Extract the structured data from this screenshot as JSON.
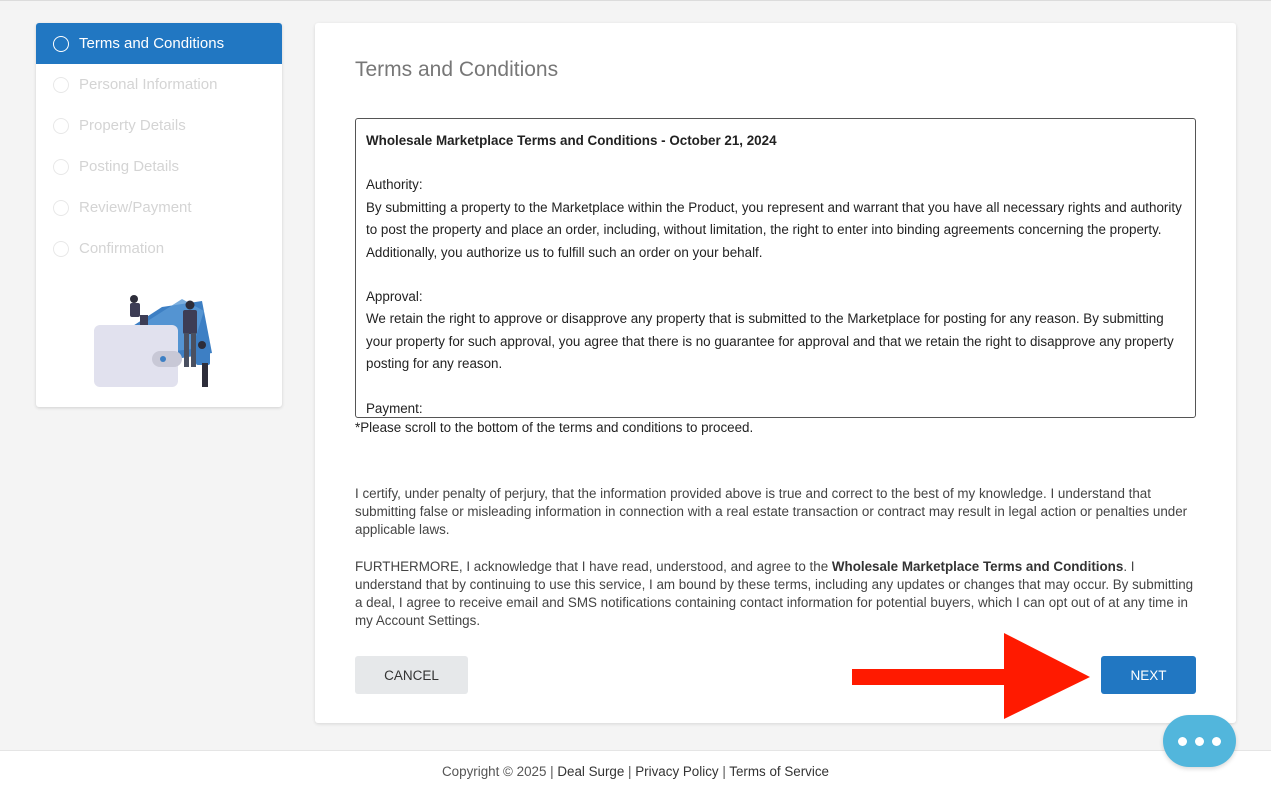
{
  "sidebar": {
    "steps": [
      {
        "label": "Terms and Conditions"
      },
      {
        "label": "Personal Information"
      },
      {
        "label": "Property Details"
      },
      {
        "label": "Posting Details"
      },
      {
        "label": "Review/Payment"
      },
      {
        "label": "Confirmation"
      }
    ]
  },
  "main": {
    "title": "Terms and Conditions",
    "terms": {
      "heading": "Wholesale Marketplace Terms and Conditions - October 21, 2024",
      "authority_label": "Authority:",
      "authority_text": "By submitting a property to the Marketplace within the Product, you represent and warrant that you have all necessary rights and authority to post the property and place an order, including, without limitation, the right to enter into binding agreements concerning the property. Additionally, you authorize us to fulfill such an order on your behalf.",
      "approval_label": "Approval:",
      "approval_text": "We retain the right to approve or disapprove any property that is submitted to the Marketplace for posting for any reason. By submitting your property for such approval, you agree that there is no guarantee for approval and that we retain the right to disapprove any property posting for any reason.",
      "payment_label": "Payment:"
    },
    "scroll_note": "*Please scroll to the bottom of the terms and conditions to proceed.",
    "certify_text": "I certify, under penalty of perjury, that the information provided above is true and correct to the best of my knowledge. I understand that submitting false or misleading information in connection with a real estate transaction or contract may result in legal action or penalties under applicable laws.",
    "furthermore_prefix": "FURTHERMORE, I acknowledge that I have read, understood, and agree to the ",
    "furthermore_bold": "Wholesale Marketplace Terms and Conditions",
    "furthermore_suffix": ". I understand that by continuing to use this service, I am bound by these terms, including any updates or changes that may occur. By submitting a deal, I agree to receive email and SMS notifications containing contact information for potential buyers, which I can opt out of at any time in my Account Settings.",
    "cancel_label": "CANCEL",
    "next_label": "NEXT"
  },
  "footer": {
    "copyright": "Copyright © 2025 | ",
    "deal_surge": "Deal Surge",
    "sep1": " | ",
    "privacy": "Privacy Policy",
    "sep2": " | ",
    "terms": "Terms of Service"
  },
  "colors": {
    "accent": "#2177c2",
    "chat": "#52b6dc",
    "arrow": "#ff1a00"
  },
  "icons": {
    "chat": "chat-dots-icon",
    "step": "circle-icon",
    "arrow": "red-arrow-annotation"
  }
}
